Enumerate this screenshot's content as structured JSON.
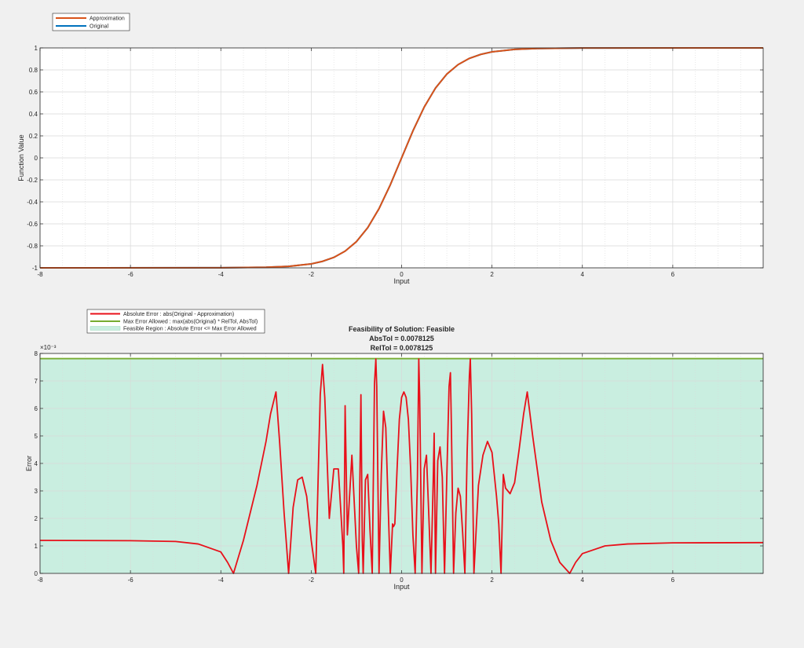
{
  "colors": {
    "approximation": "#d95319",
    "original": "#0072bd",
    "error": "#e8101a",
    "max_error": "#77ac30",
    "feasible_fill": "#c9eee0",
    "feasible_edge": "#9fd9be",
    "grid": "#d9d9d9",
    "figure_bg": "#f0f0f0"
  },
  "chart_data": [
    {
      "type": "line",
      "xlabel": "Input",
      "ylabel": "Function Value",
      "xlim": [
        -8,
        8
      ],
      "ylim": [
        -1,
        1
      ],
      "xticks": [
        -8,
        -6,
        -4,
        -2,
        0,
        2,
        4,
        6
      ],
      "xtick_labels": [
        "-8",
        "-6",
        "-4",
        "-2",
        "0",
        "2",
        "4",
        "6"
      ],
      "yticks": [
        -1,
        -0.8,
        -0.6,
        -0.4,
        -0.2,
        0,
        0.2,
        0.4,
        0.6,
        0.8,
        1
      ],
      "ytick_labels": [
        "-1",
        "-0.8",
        "-0.6",
        "-0.4",
        "-0.2",
        "0",
        "0.2",
        "0.4",
        "0.6",
        "0.8",
        "1"
      ],
      "grid": true,
      "legend_position": "top-left (outside)",
      "series": [
        {
          "name": "Approximation",
          "x": [
            -8,
            -4,
            -3,
            -2.5,
            -2,
            -1.75,
            -1.5,
            -1.25,
            -1,
            -0.75,
            -0.5,
            -0.25,
            0,
            0.25,
            0.5,
            0.75,
            1,
            1.25,
            1.5,
            1.75,
            2,
            2.5,
            3,
            4,
            8
          ],
          "y": [
            -1,
            -0.999,
            -0.995,
            -0.987,
            -0.964,
            -0.941,
            -0.905,
            -0.848,
            -0.762,
            -0.635,
            -0.462,
            -0.245,
            0,
            0.245,
            0.462,
            0.635,
            0.762,
            0.848,
            0.905,
            0.941,
            0.964,
            0.987,
            0.995,
            0.999,
            1
          ]
        },
        {
          "name": "Original",
          "x": [
            -8,
            -4,
            -3,
            -2.5,
            -2,
            -1.75,
            -1.5,
            -1.25,
            -1,
            -0.75,
            -0.5,
            -0.25,
            0,
            0.25,
            0.5,
            0.75,
            1,
            1.25,
            1.5,
            1.75,
            2,
            2.5,
            3,
            4,
            8
          ],
          "y": [
            -1,
            -0.999,
            -0.995,
            -0.987,
            -0.964,
            -0.941,
            -0.905,
            -0.848,
            -0.762,
            -0.635,
            -0.462,
            -0.245,
            0,
            0.245,
            0.462,
            0.635,
            0.762,
            0.848,
            0.905,
            0.941,
            0.964,
            0.987,
            0.995,
            0.999,
            1
          ]
        }
      ]
    },
    {
      "type": "line",
      "title": [
        "Feasibility of Solution: Feasible",
        "AbsTol = 0.0078125",
        "RelTol = 0.0078125"
      ],
      "xlabel": "Input",
      "ylabel": "Error",
      "y_exponent_label": "×10⁻³",
      "xlim": [
        -8,
        8
      ],
      "ylim": [
        0,
        0.008
      ],
      "xticks": [
        -8,
        -6,
        -4,
        -2,
        0,
        2,
        4,
        6
      ],
      "xtick_labels": [
        "-8",
        "-6",
        "-4",
        "-2",
        "0",
        "2",
        "4",
        "6"
      ],
      "yticks": [
        0,
        0.001,
        0.002,
        0.003,
        0.004,
        0.005,
        0.006,
        0.007,
        0.008
      ],
      "ytick_labels": [
        "0",
        "1",
        "2",
        "3",
        "4",
        "5",
        "6",
        "7",
        "8"
      ],
      "grid": true,
      "legend_position": "top-left (outside)",
      "series": [
        {
          "name": "Absolute Error : abs(Original - Approximation)",
          "x": [
            -8,
            -6,
            -5,
            -4.5,
            -4,
            -3.85,
            -3.72,
            -3.5,
            -3.2,
            -3,
            -2.9,
            -2.78,
            -2.7,
            -2.6,
            -2.5,
            -2.4,
            -2.3,
            -2.2,
            -2.1,
            -2.0,
            -1.9,
            -1.8,
            -1.75,
            -1.7,
            -1.6,
            -1.5,
            -1.4,
            -1.3,
            -1.28,
            -1.25,
            -1.2,
            -1.1,
            -1.0,
            -0.95,
            -0.9,
            -0.87,
            -0.85,
            -0.8,
            -0.75,
            -0.7,
            -0.65,
            -0.6,
            -0.57,
            -0.55,
            -0.5,
            -0.45,
            -0.4,
            -0.35,
            -0.3,
            -0.25,
            -0.2,
            -0.18,
            -0.15,
            -0.1,
            -0.05,
            0,
            0.05,
            0.1,
            0.15,
            0.2,
            0.25,
            0.3,
            0.35,
            0.38,
            0.4,
            0.45,
            0.5,
            0.55,
            0.6,
            0.65,
            0.7,
            0.72,
            0.75,
            0.8,
            0.85,
            0.9,
            0.95,
            1.0,
            1.05,
            1.08,
            1.1,
            1.15,
            1.2,
            1.25,
            1.3,
            1.35,
            1.4,
            1.45,
            1.5,
            1.52,
            1.55,
            1.6,
            1.7,
            1.8,
            1.9,
            2.0,
            2.1,
            2.15,
            2.2,
            2.25,
            2.3,
            2.4,
            2.5,
            2.6,
            2.7,
            2.78,
            2.9,
            3.1,
            3.3,
            3.5,
            3.72,
            3.85,
            4,
            4.5,
            5,
            6,
            8
          ],
          "y": [
            0.0012,
            0.00119,
            0.00116,
            0.00107,
            0.00078,
            0.0004,
            0,
            0.0012,
            0.0032,
            0.0048,
            0.0058,
            0.0066,
            0.0048,
            0.0022,
            0,
            0.0024,
            0.0034,
            0.0035,
            0.0028,
            0.0012,
            0,
            0.0065,
            0.0076,
            0.0064,
            0.002,
            0.0038,
            0.0038,
            0.001,
            0,
            0.0061,
            0.0014,
            0.0043,
            0.001,
            0,
            0.0065,
            0.0012,
            0,
            0.0034,
            0.0036,
            0.0016,
            0,
            0.0069,
            0.0078,
            0.0068,
            0,
            0.0036,
            0.0059,
            0.0053,
            0.0026,
            0,
            0.0018,
            0.0017,
            0.0018,
            0.0038,
            0.0056,
            0.0064,
            0.0066,
            0.0064,
            0.0056,
            0.0038,
            0.0014,
            0,
            0.0035,
            0.0078,
            0.0064,
            0,
            0.0038,
            0.0043,
            0.0022,
            0,
            0.0034,
            0.0051,
            0,
            0.0041,
            0.0046,
            0.0035,
            0,
            0.0035,
            0.0068,
            0.0073,
            0.0055,
            0,
            0.0022,
            0.0031,
            0.0028,
            0.0015,
            0,
            0.0044,
            0.0072,
            0.0078,
            0.0058,
            0,
            0.0032,
            0.0043,
            0.0048,
            0.0044,
            0.0028,
            0.0018,
            0,
            0.0036,
            0.0031,
            0.0029,
            0.0033,
            0.0045,
            0.0058,
            0.0066,
            0.005,
            0.0026,
            0.0012,
            0.0004,
            0,
            0.0004,
            0.00072,
            0.001,
            0.00107,
            0.00111,
            0.00112
          ]
        },
        {
          "name": "Max Error Allowed : max(abs(Original) * RelTol, AbsTol)",
          "x": [
            -8,
            8
          ],
          "y": [
            0.0078125,
            0.0078125
          ]
        },
        {
          "name": "Feasible Region : Absolute Error <= Max Error Allowed",
          "x": [
            -8,
            8
          ],
          "y": [
            0.0078125,
            0.0078125
          ]
        }
      ]
    }
  ]
}
